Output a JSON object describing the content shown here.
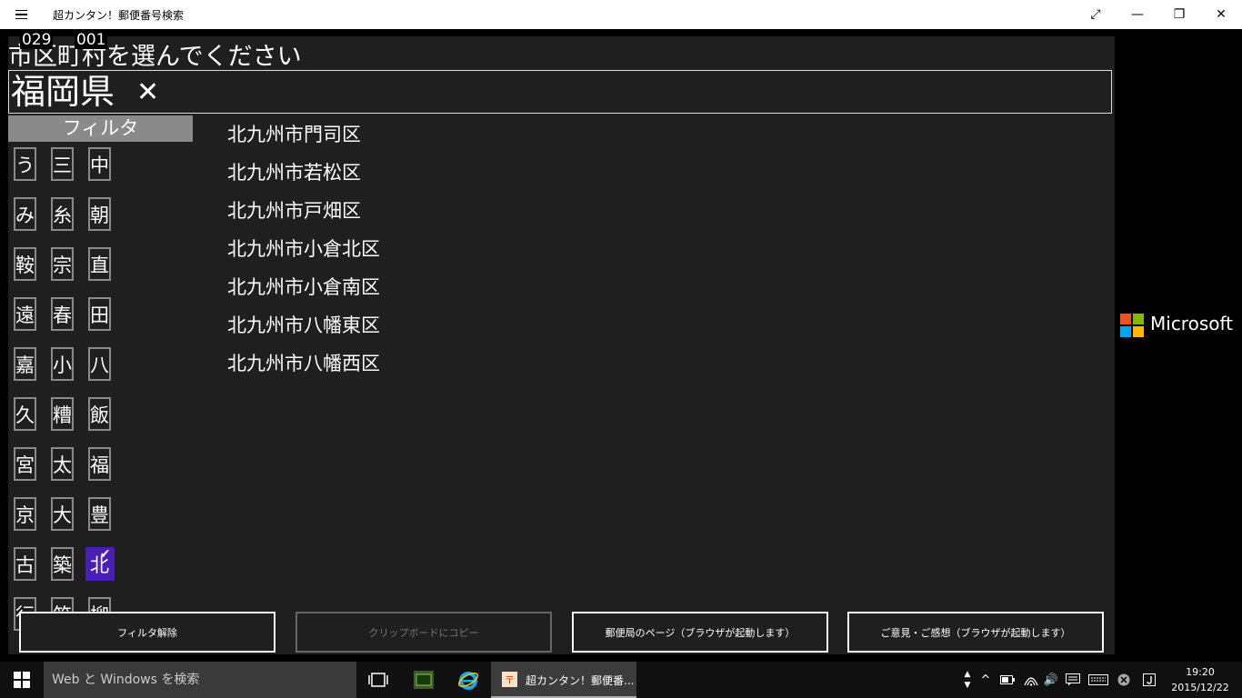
{
  "window": {
    "title": "超カンタン！郵便番号検索"
  },
  "counters": [
    "029",
    "001"
  ],
  "heading": "市区町村を選んでください",
  "prefecture": {
    "name": "福岡県",
    "clear_icon": "✕"
  },
  "filter": {
    "header": "フィルタ",
    "items": [
      "う",
      "三",
      "中",
      "み",
      "糸",
      "朝",
      "鞍",
      "宗",
      "直",
      "遠",
      "春",
      "田",
      "嘉",
      "小",
      "八",
      "久",
      "糟",
      "飯",
      "宮",
      "太",
      "福",
      "京",
      "大",
      "豊",
      "古",
      "築",
      "北",
      "行",
      "筑",
      "柳"
    ],
    "selected": "北"
  },
  "results": [
    "北九州市門司区",
    "北九州市若松区",
    "北九州市戸畑区",
    "北九州市小倉北区",
    "北九州市小倉南区",
    "北九州市八幡東区",
    "北九州市八幡西区"
  ],
  "ad": {
    "brand": "Microsoft",
    "colors": [
      "#f25022",
      "#7fba00",
      "#00a4ef",
      "#ffb900"
    ]
  },
  "buttons": {
    "clear_filter": "フィルタ解除",
    "copy": "クリップボードにコピー",
    "post_office": "郵便局のページ（ブラウザが起動します）",
    "feedback": "ご意見・ご感想（ブラウザが起動します）"
  },
  "taskbar": {
    "search_placeholder": "Web と Windows を検索",
    "active_app": "超カンタン！郵便番...",
    "time": "19:20",
    "date": "2015/12/22"
  }
}
